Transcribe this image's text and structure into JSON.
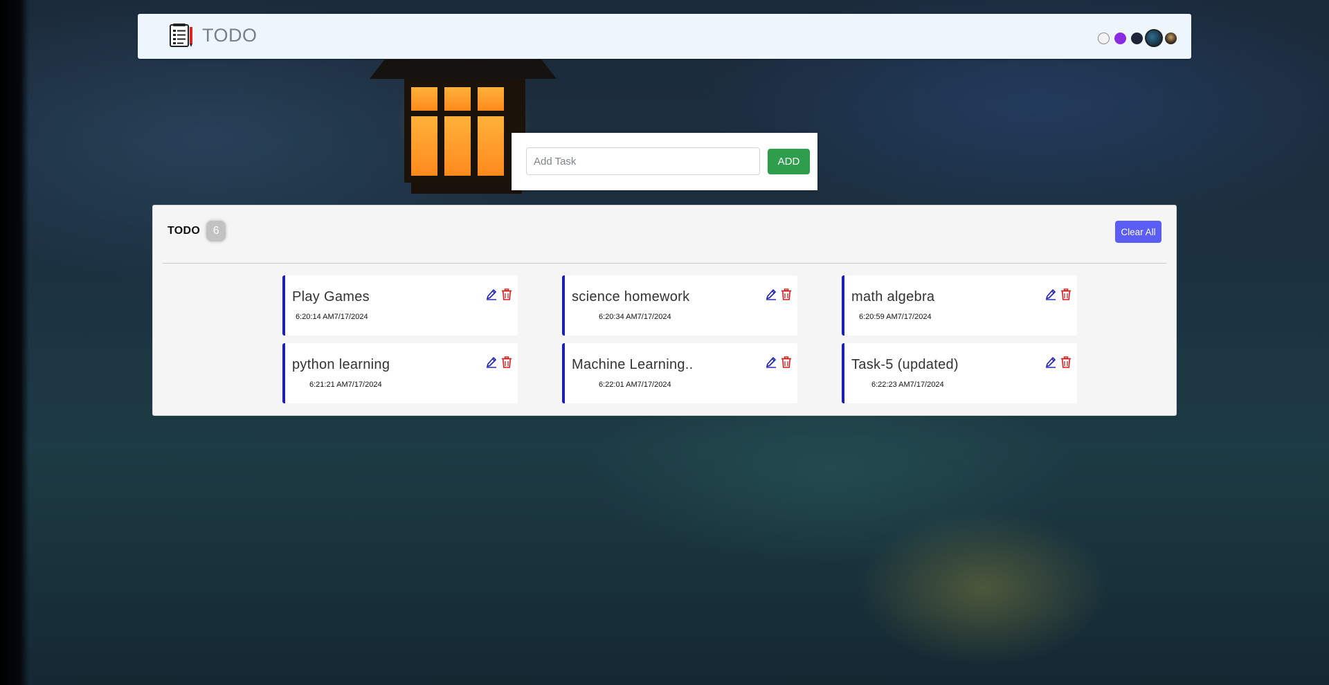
{
  "navbar": {
    "title": "TODO",
    "brand_icon": "notepad-icon",
    "themes": [
      {
        "name": "theme-white",
        "color": "#f3f3f3"
      },
      {
        "name": "theme-purple",
        "color": "#8a2be2"
      },
      {
        "name": "theme-dark",
        "color": "#1f2538"
      },
      {
        "name": "theme-forest",
        "color": "#2e6e8e"
      },
      {
        "name": "theme-lantern",
        "color": "#caa060"
      }
    ]
  },
  "add_task": {
    "placeholder": "Add Task",
    "value": "",
    "button_label": "ADD",
    "button_color": "#2f9e4c"
  },
  "todo_panel": {
    "title": "TODO",
    "count": "6",
    "clear_label": "Clear All",
    "clear_color": "#5b5ef5",
    "tasks": [
      {
        "title": "Play Games",
        "time": "6:20:14 AM7/17/2024"
      },
      {
        "title": "science homework",
        "time": "6:20:34 AM7/17/2024"
      },
      {
        "title": "math algebra",
        "time": "6:20:59 AM7/17/2024"
      },
      {
        "title": "python learning",
        "time": "6:21:21 AM7/17/2024"
      },
      {
        "title": "Machine Learning..",
        "time": "6:22:01 AM7/17/2024"
      },
      {
        "title": "Task-5 (updated)",
        "time": "6:22:23 AM7/17/2024"
      }
    ]
  },
  "colors": {
    "card_accent": "#1c1fb5",
    "edit_icon": "#1c1fb5",
    "delete_icon": "#d91c1c"
  }
}
